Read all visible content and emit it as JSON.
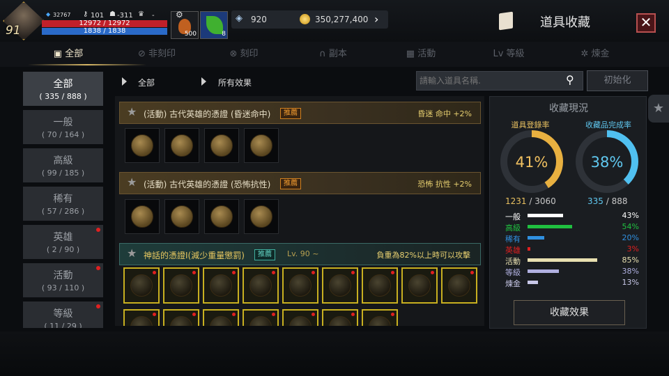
{
  "player": {
    "level": "91",
    "exp_value": "32767",
    "keys": "101",
    "helm": "-311",
    "trophy": "-",
    "hp": "12972 / 12972",
    "mp": "1838 / 1838"
  },
  "potions": [
    {
      "icon": "potion-bottle-icon",
      "count": "500"
    },
    {
      "icon": "leaf-icon",
      "count": "8"
    }
  ],
  "currency": {
    "crystal": "920",
    "gold": "350,277,400"
  },
  "title": "道具收藏",
  "tabs": [
    {
      "label": "全部",
      "icon": "book-icon"
    },
    {
      "label": "非刻印",
      "icon": "no-engrave-icon"
    },
    {
      "label": "刻印",
      "icon": "engrave-icon"
    },
    {
      "label": "副本",
      "icon": "helmet-icon"
    },
    {
      "label": "活動",
      "icon": "gift-icon"
    },
    {
      "label": "等級",
      "icon": "lv-icon"
    },
    {
      "label": "煉金",
      "icon": "alchemy-icon"
    }
  ],
  "sidebar": [
    {
      "name": "全部",
      "count": "( 335 / 888 )",
      "active": true,
      "dot": false
    },
    {
      "name": "一般",
      "count": "( 70 / 164 )",
      "active": false,
      "dot": false
    },
    {
      "name": "高級",
      "count": "( 99 / 185 )",
      "active": false,
      "dot": false
    },
    {
      "name": "稀有",
      "count": "( 57 / 286 )",
      "active": false,
      "dot": false
    },
    {
      "name": "英雄",
      "count": "( 2 / 90 )",
      "active": false,
      "dot": true
    },
    {
      "name": "活動",
      "count": "( 93 / 110 )",
      "active": false,
      "dot": true
    },
    {
      "name": "等級",
      "count": "( 11 / 29 )",
      "active": false,
      "dot": true
    }
  ],
  "filter": {
    "category": "全部",
    "effect": "所有效果"
  },
  "search": {
    "placeholder": "請輸入道具名稱.",
    "reset": "初始化"
  },
  "entries": [
    {
      "title": "(活動) 古代英雄的憑證 (昏迷命中)",
      "badge": "推薦",
      "effect": "昏迷 命中 +2%",
      "level": "",
      "type": "gold",
      "slots": 4
    },
    {
      "title": "(活動) 古代英雄的憑證 (恐怖抗性)",
      "badge": "推薦",
      "effect": "恐怖 抗性 +2%",
      "level": "",
      "type": "gold",
      "slots": 4
    },
    {
      "title": "神話的憑證I(減少重量懲罰)",
      "badge": "推薦",
      "effect": "負重為82%以上時可以攻擊",
      "level": "Lv. 90 ~",
      "type": "teal",
      "slots": 9
    }
  ],
  "panel": {
    "title": "收藏現況",
    "reg_label": "道具登錄率",
    "comp_label": "收藏品完成率",
    "reg_pct": "41%",
    "comp_pct": "38%",
    "reg_fraction": 0.41,
    "comp_fraction": 0.38,
    "reg_done": "1231",
    "reg_total": "/ 3060",
    "comp_done": "335",
    "comp_total": "/ 888",
    "button": "收藏效果",
    "rows": [
      {
        "label": "一般",
        "pct": "43%",
        "value": 43,
        "color": "#ffffff"
      },
      {
        "label": "高級",
        "pct": "54%",
        "value": 54,
        "color": "#20c040"
      },
      {
        "label": "稀有",
        "pct": "20%",
        "value": 20,
        "color": "#3090e0"
      },
      {
        "label": "英雄",
        "pct": "3%",
        "value": 3,
        "color": "#e02020"
      },
      {
        "label": "活動",
        "pct": "85%",
        "value": 85,
        "color": "#e8e0b0"
      },
      {
        "label": "等級",
        "pct": "38%",
        "value": 38,
        "color": "#b0b0e0"
      },
      {
        "label": "煉金",
        "pct": "13%",
        "value": 13,
        "color": "#c8c8e8"
      }
    ]
  }
}
